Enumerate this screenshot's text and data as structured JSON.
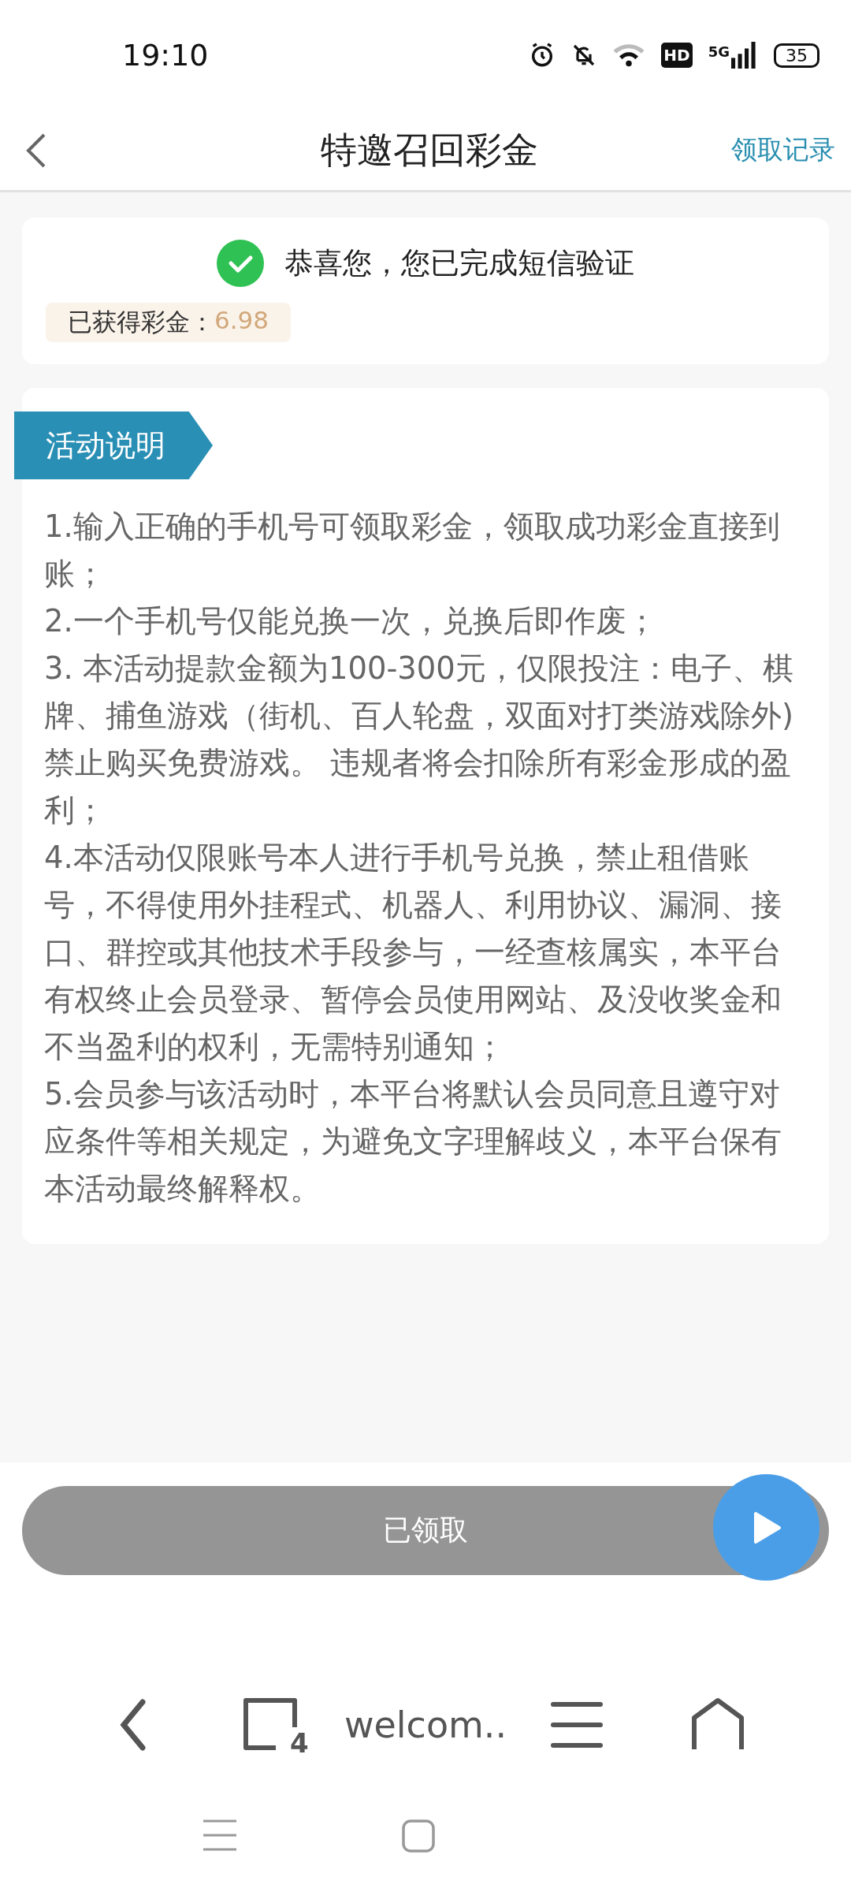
{
  "status_bar": {
    "time": "19:10",
    "network": "5G",
    "hd": "HD",
    "battery": "35"
  },
  "header": {
    "title": "特邀召回彩金",
    "action": "领取记录"
  },
  "result_card": {
    "message": "恭喜您，您已完成短信验证",
    "reward_label": "已获得彩金：",
    "reward_value": "6.98"
  },
  "rules_card": {
    "tag": "活动说明",
    "items": [
      "1.输入正确的手机号可领取彩金，领取成功彩金直接到账；",
      "2.一个手机号仅能兑换一次，兑换后即作废；",
      "3. 本活动提款金额为100-300元，仅限投注：电子、棋牌、捕鱼游戏（街机、百人轮盘，双面对打类游戏除外) 禁止购买免费游戏。 违规者将会扣除所有彩金形成的盈利；",
      "4.本活动仅限账号本人进行手机号兑换，禁止租借账号，不得使用外挂程式、机器人、利用协议、漏洞、接口、群控或其他技术手段参与，一经查核属实，本平台有权终止会员登录、暂停会员使用网站、及没收奖金和不当盈利的权利，无需特别通知；",
      "5.会员参与该活动时，本平台将默认会员同意且遵守对应条件等相关规定，为避免文字理解歧义，本平台保有本活动最终解释权。"
    ]
  },
  "claim_button": {
    "label": "已领取",
    "disabled": true
  },
  "browser_bar": {
    "tab_count": "4",
    "address": "welcom.."
  }
}
